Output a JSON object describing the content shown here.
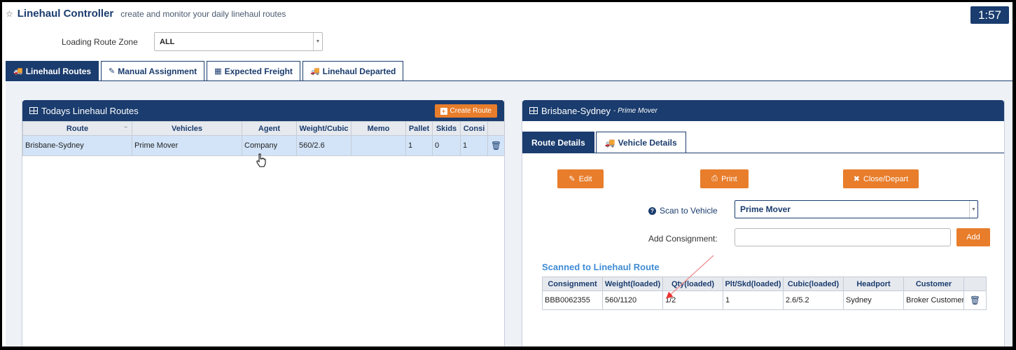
{
  "header": {
    "title": "Linehaul Controller",
    "subtitle": "create and monitor your daily linehaul routes",
    "timer": "1:57"
  },
  "zone": {
    "label": "Loading Route Zone",
    "value": "ALL"
  },
  "tabs": [
    {
      "label": "Linehaul Routes",
      "icon": "truck-icon",
      "active": true
    },
    {
      "label": "Manual Assignment",
      "icon": "edit-icon",
      "active": false
    },
    {
      "label": "Expected Freight",
      "icon": "calendar-icon",
      "active": false
    },
    {
      "label": "Linehaul Departed",
      "icon": "truck-icon",
      "active": false
    }
  ],
  "routes_panel": {
    "title": "Todays Linehaul Routes",
    "create_label": "Create Route",
    "columns": [
      "Route",
      "Vehicles",
      "Agent",
      "Weight/Cubic",
      "Memo",
      "Pallet",
      "Skids",
      "Consi"
    ],
    "rows": [
      {
        "route": "Brisbane-Sydney",
        "vehicles": "Prime Mover",
        "agent": "Company",
        "weight": "560/2.6",
        "memo": "",
        "pallet": "1",
        "skids": "0",
        "consi": "1"
      }
    ]
  },
  "detail_panel": {
    "title": "Brisbane-Sydney",
    "subtitle": "- Prime Mover",
    "sub_tabs": [
      {
        "label": "Route Details",
        "active": true
      },
      {
        "label": "Vehicle Details",
        "icon": "truck-icon",
        "active": false
      }
    ],
    "buttons": {
      "edit": "Edit",
      "print": "Print",
      "close": "Close/Depart"
    },
    "scan_label": "Scan to Vehicle",
    "scan_value": "Prime Mover",
    "add_label": "Add Consignment:",
    "add_placeholder": "",
    "add_button": "Add",
    "scanned_title": "Scanned to Linehaul Route",
    "columns": [
      "Consignment",
      "Weight(loaded)",
      "Qty(loaded)",
      "Plt/Skd(loaded)",
      "Cubic(loaded)",
      "Headport",
      "Customer"
    ],
    "rows": [
      {
        "consignment": "BBB0062355",
        "weight": "560/1120",
        "qty": "1/2",
        "plt": "1",
        "cubic": "2.6/5.2",
        "headport": "Sydney",
        "customer": "Broker Customer"
      }
    ]
  },
  "colors": {
    "navy": "#1a3c6e",
    "orange": "#e87d2b",
    "accent_blue": "#3f8cd6",
    "selected_row": "#d3e4f8"
  }
}
